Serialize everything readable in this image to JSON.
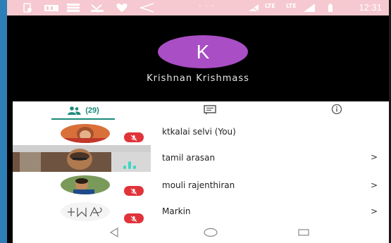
{
  "status_bar": {
    "time": "12:31",
    "dots": "· · ·",
    "lte_1": "LTE",
    "lte_2": "LTE"
  },
  "host": {
    "initial": "K",
    "name": "Krishnan Krishmass",
    "avatar_color": "#a94ec4"
  },
  "tabs": {
    "participants_count": "(29)",
    "accent_color": "#1a8a7a"
  },
  "participants": [
    {
      "name": "ktkalai selvi (You)",
      "mic_muted": true,
      "has_chevron": false
    },
    {
      "name": "tamil arasan",
      "mic_muted": false,
      "has_chevron": true,
      "speaking": true
    },
    {
      "name": "mouli rajenthiran",
      "mic_muted": true,
      "has_chevron": true
    },
    {
      "name": "Markin",
      "mic_muted": true,
      "has_chevron": true
    }
  ],
  "chevron": ">",
  "mute_color": "#e0333a",
  "icons": {
    "people": "people-icon",
    "chat": "chat-icon",
    "info": "info-icon",
    "back": "back-icon",
    "home": "home-icon",
    "recents": "recents-icon"
  }
}
